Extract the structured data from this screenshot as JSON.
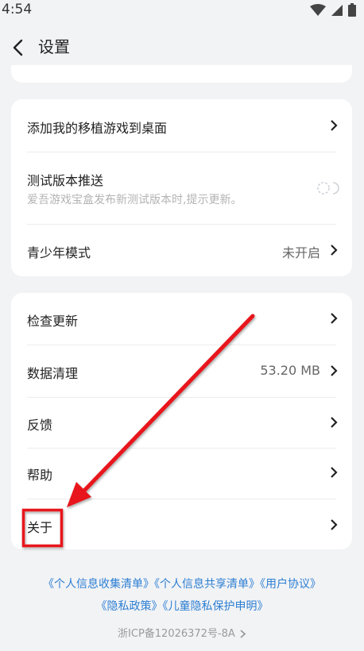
{
  "status": {
    "time": "4:54"
  },
  "header": {
    "title": "设置"
  },
  "group1": {
    "add_to_desktop": "添加我的移植游戏到桌面",
    "beta_push_title": "测试版本推送",
    "beta_push_desc": "爱吾游戏宝盒发布新测试版本时,提示更新。",
    "teen_mode_label": "青少年模式",
    "teen_mode_value": "未开启"
  },
  "group2": {
    "check_update": "检查更新",
    "data_clean_label": "数据清理",
    "data_clean_value": "53.20 MB",
    "feedback": "反馈",
    "help": "帮助",
    "about": "关于"
  },
  "footer": {
    "link_collect": "《个人信息收集清单》",
    "link_share": "《个人信息共享清单》",
    "link_agreement": "《用户协议》",
    "link_privacy": "《隐私政策》",
    "link_child": "《儿童隐私保护申明》",
    "icp": "浙ICP备12026372号-8A"
  },
  "icons": [
    "wifi-icon",
    "signal-icon",
    "battery-icon",
    "back-arrow-icon",
    "chevron-right-icon",
    "loading-toggle-icon",
    "annotation-arrow"
  ],
  "colors": {
    "link": "#2d7fd3",
    "annotation": "#e8141b",
    "background": "#f2f3f5"
  }
}
